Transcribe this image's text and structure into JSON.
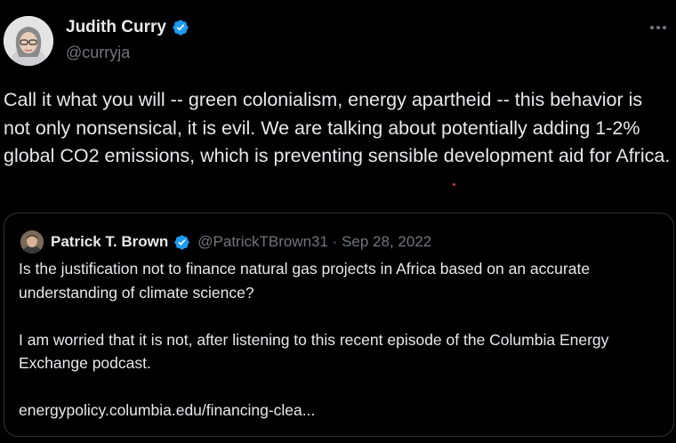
{
  "tweet": {
    "author": {
      "display_name": "Judith Curry",
      "handle": "@curryja",
      "verified_icon": "verified-badge-icon",
      "avatar": "avatar"
    },
    "text": "Call it what you will -- green colonialism, energy apartheid -- this behavior is not only nonsensical, it is evil.  We are talking about potentially adding 1-2% global CO2 emissions, which is preventing sensible development aid for Africa.",
    "more_icon": "more-options-icon"
  },
  "quote": {
    "author": {
      "display_name": "Patrick T. Brown",
      "handle_and_date": "@PatrickTBrown31 · Sep 28, 2022",
      "verified_icon": "verified-badge-icon"
    },
    "paragraphs": [
      "Is the justification not to finance natural gas projects in Africa based on an accurate understanding of climate science?",
      "I am worried that it is not, after listening to this recent episode of the Columbia Energy Exchange podcast.",
      "energypolicy.columbia.edu/financing-clea..."
    ]
  },
  "colors": {
    "background": "#000000",
    "text_primary": "#e7e9ea",
    "text_secondary": "#71767b",
    "verified_blue": "#1d9bf0",
    "card_border": "#2f3336"
  }
}
